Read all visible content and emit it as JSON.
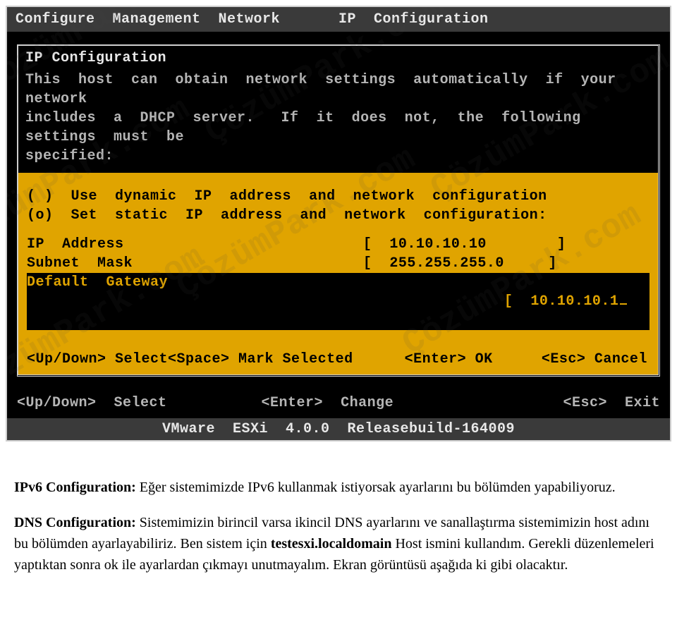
{
  "header": {
    "left": "Configure  Management  Network",
    "right": "IP  Configuration"
  },
  "dialog": {
    "title": "IP  Configuration",
    "help": "This  host  can  obtain  network  settings  automatically  if  your  network\nincludes  a  DHCP  server.   If  it  does  not,  the  following  settings  must  be\nspecified:",
    "radios": {
      "dynamic": "( )  Use  dynamic  IP  address  and  network  configuration",
      "staticv": "(o)  Set  static  IP  address  and  network  configuration:"
    },
    "fields": {
      "ip_label": "IP  Address",
      "ip_value": "[  10.10.10.10        ]",
      "mask_label": "Subnet  Mask",
      "mask_value": "[  255.255.255.0     ]",
      "gw_label": "Default  Gateway",
      "gw_value_prefix": "[  10.10.10.1",
      "gw_value_suffix": "        ]"
    },
    "keyhints": {
      "updown": "<Up/Down> Select",
      "space": "<Space> Mark Selected",
      "enter": "<Enter> OK",
      "esc": "<Esc> Cancel"
    }
  },
  "outer_hints": {
    "updown": "<Up/Down>  Select",
    "enter": "<Enter>  Change",
    "esc": "<Esc>  Exit"
  },
  "status_bar": "VMware  ESXi  4.0.0  Releasebuild-164009",
  "watermark": "ÇözümPark.com",
  "doc": {
    "p1_label": "IPv6 Configuration:",
    "p1_rest": " Eğer sistemimizde IPv6 kullanmak istiyorsak ayarlarını bu bölümden yapabiliyoruz.",
    "p2_label": "DNS Configuration:",
    "p2_rest_a": " Sistemimizin birincil varsa ikincil DNS ayarlarını ve sanallaştırma sistemimizin host adını bu bölümden ayarlayabiliriz. Ben sistem için ",
    "p2_bold": "testesxi.localdomain",
    "p2_rest_b": " Host ismini kullandım. Gerekli düzenlemeleri yaptıktan sonra ok ile ayarlardan çıkmayı unutmayalım. Ekran görüntüsü aşağıda ki gibi olacaktır."
  }
}
